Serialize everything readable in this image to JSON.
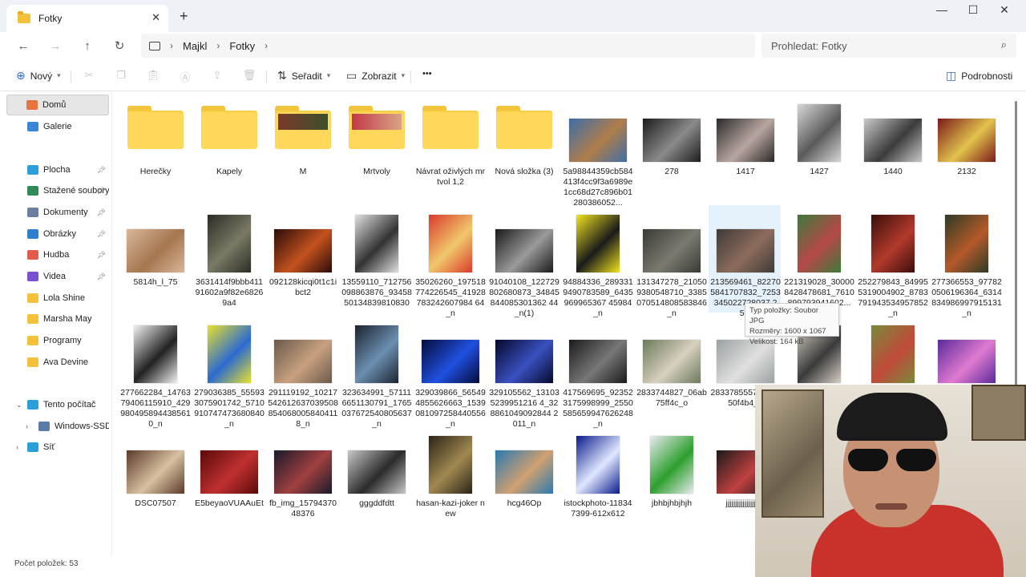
{
  "window": {
    "tab_title": "Fotky",
    "close_tab": "✕",
    "new_tab": "+",
    "minimize": "—",
    "maximize": "☐",
    "close": "✕"
  },
  "nav": {
    "back": "←",
    "forward": "→",
    "up": "↑",
    "refresh": "↻",
    "breadcrumb": [
      "Majkl",
      "Fotky"
    ],
    "search_placeholder": "Prohledat: Fotky"
  },
  "commands": {
    "new": "Nový",
    "sort": "Seřadit",
    "view": "Zobrazit",
    "more": "•••",
    "details": "Podrobnosti"
  },
  "sidebar": {
    "items": [
      {
        "label": "Domů",
        "icon": "home-icon",
        "color": "#e8743b",
        "active": true
      },
      {
        "label": "Galerie",
        "icon": "gallery-icon",
        "color": "#3a86d6"
      },
      {
        "label": "Plocha",
        "icon": "desktop-icon",
        "color": "#2a9fd8",
        "pinned": true
      },
      {
        "label": "Stažené soubory",
        "icon": "download-icon",
        "color": "#2e8b57",
        "pinned": true
      },
      {
        "label": "Dokumenty",
        "icon": "documents-icon",
        "color": "#6a7fa0",
        "pinned": true
      },
      {
        "label": "Obrázky",
        "icon": "pictures-icon",
        "color": "#2f7fd1",
        "pinned": true
      },
      {
        "label": "Hudba",
        "icon": "music-icon",
        "color": "#e25b4b",
        "pinned": true
      },
      {
        "label": "Videa",
        "icon": "videos-icon",
        "color": "#7a4fd1",
        "pinned": true
      },
      {
        "label": "Lola Shine",
        "icon": "folder-icon",
        "color": "#f3c13a"
      },
      {
        "label": "Marsha May",
        "icon": "folder-icon",
        "color": "#f3c13a"
      },
      {
        "label": "Programy",
        "icon": "folder-icon",
        "color": "#f3c13a"
      },
      {
        "label": "Ava Devine",
        "icon": "folder-icon",
        "color": "#f3c13a"
      },
      {
        "label": "Tento počítač",
        "icon": "computer-icon",
        "color": "#2a9fd8"
      },
      {
        "label": "Windows-SSD (C:)",
        "icon": "drive-icon",
        "color": "#5a7ca8"
      },
      {
        "label": "Síť",
        "icon": "network-icon",
        "color": "#2a9fd8"
      }
    ]
  },
  "tiles": [
    {
      "name": "Herečky",
      "kind": "folder"
    },
    {
      "name": "Kapely",
      "kind": "folder"
    },
    {
      "name": "M",
      "kind": "folder-photo",
      "colors": [
        "#7a3b2a",
        "#3c4f2a"
      ]
    },
    {
      "name": "Mrtvoly",
      "kind": "folder-photo",
      "colors": [
        "#c23a48",
        "#d9a387"
      ]
    },
    {
      "name": "Návrat oživlých mrtvol 1,2",
      "kind": "folder"
    },
    {
      "name": "Nová složka (3)",
      "kind": "folder"
    },
    {
      "name": "5a98844359cb584413f4cc9f3a6989e1cc68d27c896b01280386052...",
      "kind": "img",
      "colors": [
        "#3d6ea6",
        "#b07d4a"
      ]
    },
    {
      "name": "278",
      "kind": "img",
      "colors": [
        "#1c1c1c",
        "#8b8b8b"
      ]
    },
    {
      "name": "1417",
      "kind": "img",
      "colors": [
        "#2a2a2a",
        "#b9a6a0"
      ]
    },
    {
      "name": "1427",
      "kind": "img",
      "colors": [
        "#d8d8d8",
        "#5a5a5a"
      ],
      "tall": true
    },
    {
      "name": "1440",
      "kind": "img",
      "colors": [
        "#c9c9c9",
        "#3b3b3b"
      ]
    },
    {
      "name": "2132",
      "kind": "img",
      "colors": [
        "#7b1a1a",
        "#e2c24c"
      ]
    },
    {
      "name": "5814h_l_75",
      "kind": "img",
      "colors": [
        "#d9b79a",
        "#a5764f"
      ]
    },
    {
      "name": "3631414f9bbb41191602a9f82e68269a4",
      "kind": "img",
      "colors": [
        "#2b2b25",
        "#7a7a66"
      ],
      "tall": true
    },
    {
      "name": "092128kicqi0t1c1ibct2",
      "kind": "img",
      "colors": [
        "#2a0c08",
        "#c4521e"
      ]
    },
    {
      "name": "13559110_712756098863876_9345850134839810830",
      "kind": "img",
      "colors": [
        "#e0e0e0",
        "#333"
      ],
      "tall": true
    },
    {
      "name": "35026260_197518774226545_41928783242607984 64_n",
      "kind": "img",
      "colors": [
        "#d93a2b",
        "#f0c86b"
      ],
      "tall": true
    },
    {
      "name": "91040108_122729802680873_34845844085301362 44_n(1)",
      "kind": "img",
      "colors": [
        "#1a1a1a",
        "#9a9a9a"
      ]
    },
    {
      "name": "94884336_2893319490783589_6435969965367 45984_n",
      "kind": "img",
      "colors": [
        "#f1e31f",
        "#1a1a1a"
      ],
      "tall": true
    },
    {
      "name": "131347278_210509380548710_3385070514808583846_n",
      "kind": "img",
      "colors": [
        "#3a3a36",
        "#7a7a70"
      ]
    },
    {
      "name": "213569461_822705841707832_7253345022728037 25...",
      "kind": "img",
      "colors": [
        "#3e3a38",
        "#8c6c5c"
      ],
      "selected": true
    },
    {
      "name": "221319028_300008428478681_7610899793941602...",
      "kind": "img",
      "colors": [
        "#3d7a3a",
        "#b64848"
      ],
      "tall": true
    },
    {
      "name": "252279843_849955319004902_8783791943534957852_n",
      "kind": "img",
      "colors": [
        "#3a0e0b",
        "#b23a2c"
      ],
      "tall": true
    },
    {
      "name": "277366553_977820506196364_6314834986997915131_n",
      "kind": "img",
      "colors": [
        "#2b3a26",
        "#b55a2a"
      ],
      "tall": true
    },
    {
      "name": "277662284_1476379406115910_4299804958944385610_n",
      "kind": "img",
      "colors": [
        "#f2f2f2",
        "#222"
      ],
      "tall": true
    },
    {
      "name": "279036385_555933075901742_5710910747473680840_n",
      "kind": "img",
      "colors": [
        "#e8e22b",
        "#2b6ad1"
      ],
      "tall": true
    },
    {
      "name": "291119192_102175426126370395088540680058404118_n",
      "kind": "img",
      "colors": [
        "#6a5a4a",
        "#c8a080"
      ]
    },
    {
      "name": "323634991_571116651130791_1765037672540805637_n",
      "kind": "img",
      "colors": [
        "#1b2330",
        "#6c8fb0"
      ],
      "tall": true
    },
    {
      "name": "329039866_565494855626663_1539081097258440556_n",
      "kind": "img",
      "colors": [
        "#040c3a",
        "#2050e0"
      ]
    },
    {
      "name": "329105562_131035239951216 4_328861049092844 2011_n",
      "kind": "img",
      "colors": [
        "#05082a",
        "#3a50c0"
      ]
    },
    {
      "name": "417569695_923523175998999_2550585659947626248_n",
      "kind": "img",
      "colors": [
        "#1a1a1a",
        "#777"
      ]
    },
    {
      "name": "2833744827_06ab75ff4c_o",
      "kind": "img",
      "colors": [
        "#6a7a5a",
        "#d8d0c0"
      ]
    },
    {
      "name": "2833785557_748c50f4b4_o",
      "kind": "img",
      "colors": [
        "#9aa0a0",
        "#e0e0e0"
      ]
    },
    {
      "name": "",
      "kind": "img",
      "colors": [
        "#d8d0c8",
        "#3a3a3a"
      ],
      "tall": true
    },
    {
      "name": "",
      "kind": "img",
      "colors": [
        "#7a8a3a",
        "#c04a3a"
      ],
      "tall": true
    },
    {
      "name": "",
      "kind": "img",
      "colors": [
        "#5a2a9a",
        "#e07ad0"
      ]
    },
    {
      "name": "DSC07507",
      "kind": "img",
      "colors": [
        "#5a3a2a",
        "#d8c0a0"
      ]
    },
    {
      "name": "E5beyaoVUAAuEt",
      "kind": "img",
      "colors": [
        "#5a0a0a",
        "#c03030"
      ]
    },
    {
      "name": "fb_img_1579437048376",
      "kind": "img",
      "colors": [
        "#1a1a2a",
        "#a04040"
      ]
    },
    {
      "name": "gggddfdtt",
      "kind": "img",
      "colors": [
        "#c8c8c8",
        "#2a2a2a"
      ]
    },
    {
      "name": "hasan-kazi-joker new",
      "kind": "img",
      "colors": [
        "#2a2418",
        "#a08850"
      ],
      "tall": true
    },
    {
      "name": "hcg46Op",
      "kind": "img",
      "colors": [
        "#2a7ab0",
        "#d0a070"
      ]
    },
    {
      "name": "istockphoto-118347399-612x612",
      "kind": "img",
      "colors": [
        "#0a1a8a",
        "#e0e8ff"
      ],
      "tall": true
    },
    {
      "name": "jbhbjhbjhjh",
      "kind": "img",
      "colors": [
        "#e9e9f0",
        "#2ca02c"
      ],
      "tall": true
    },
    {
      "name": "jjjjjjjjjjjjjjjjjjjjj",
      "kind": "img",
      "colors": [
        "#1a1a1a",
        "#c04040"
      ]
    }
  ],
  "tooltip": {
    "type": "Typ položky: Soubor JPG",
    "dims": "Rozměry: 1600 x 1067",
    "size": "Velikost: 164 kB"
  },
  "status": {
    "count": "Počet položek: 53"
  }
}
